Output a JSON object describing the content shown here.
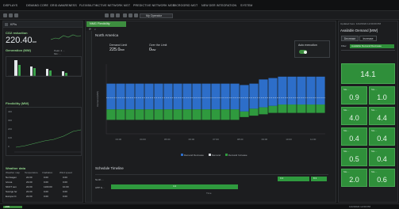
{
  "menu": {
    "items": [
      "DISPLAYS",
      "DEMAND CORE",
      "GRID AWARENESS",
      "FLEXIBILITY",
      "ACTIVE NETWORK MGT",
      "PREDICTIVE NETWORK MGT",
      "MICROGRID MGT",
      "NEW DER INTEGRATION",
      "SYSTEM"
    ]
  },
  "toolbar": {
    "operator_field": "My Operator"
  },
  "left_panel": {
    "header": "KPIs",
    "co2": {
      "title": "CO2 reduction",
      "value": "220.40",
      "unit": "ton"
    },
    "generation": {
      "title": "Generation (MW)",
      "legend": [
        "Peak: 4 ...",
        "Min: ..."
      ]
    },
    "flexibility": {
      "title": "Flexibility (MW)",
      "axis_ticks": [
        "400",
        "300",
        "200",
        "100",
        "0",
        "-100"
      ]
    },
    "weather": {
      "title": "Weather data",
      "columns": [
        "Weather map",
        "Temperature",
        "Irradiation",
        "Wind speed"
      ],
      "rows": [
        [
          "Norrsagen",
          "22.00",
          "0.00",
          "0.00"
        ],
        [
          "Ivrena",
          "23.00",
          "0.00",
          "0.00"
        ],
        [
          "SKOT sen",
          "22.00",
          "1100.00",
          "10.00"
        ],
        [
          "Sverige fer",
          "22.00",
          "0.00",
          "0.00"
        ],
        [
          "Europa Ct",
          "22.00",
          "0.00",
          "0.00"
        ]
      ]
    }
  },
  "main": {
    "tab": "NMG Flexibility",
    "region": "North America",
    "demand_limit_label": "Demand Limit",
    "demand_limit_value": "225.0",
    "demand_limit_unit": "MW",
    "over_limit_label": "Over the Limit",
    "over_limit_value": "0",
    "over_limit_unit": "MW",
    "auto_execution_label": "Auto execution",
    "schedule_title": "Schedule Timeline",
    "schedule_rows": [
      "North ...",
      "APP G..."
    ],
    "schedule_blocks": [
      "4.2",
      "3.4",
      "8.3"
    ],
    "legend": [
      "Demand Decrease",
      "Demand",
      "Demand Increase"
    ],
    "x_axis_label": "Time",
    "y_axis_label": "Demand (MW)"
  },
  "chart_data": {
    "type": "bar",
    "series": [
      {
        "name": "Demand Decrease",
        "color": "#2d6ec9",
        "top": [
          0.72,
          0.72,
          0.72,
          0.72,
          0.72,
          0.72,
          0.72,
          0.72,
          0.72,
          0.72,
          0.72,
          0.72,
          0.72,
          0.72,
          0.7,
          0.72,
          0.78,
          0.8,
          0.82,
          0.82,
          0.82,
          0.82,
          0.82
        ],
        "bottom": [
          0.35,
          0.35,
          0.35,
          0.35,
          0.35,
          0.35,
          0.35,
          0.35,
          0.35,
          0.35,
          0.35,
          0.35,
          0.35,
          0.35,
          0.32,
          0.36,
          0.38,
          0.4,
          0.42,
          0.42,
          0.42,
          0.42,
          0.42
        ]
      },
      {
        "name": "Demand Increase",
        "color": "#2f9a3e",
        "top": [
          0.35,
          0.35,
          0.35,
          0.35,
          0.35,
          0.35,
          0.35,
          0.35,
          0.35,
          0.35,
          0.35,
          0.35,
          0.35,
          0.35,
          0.32,
          0.36,
          0.38,
          0.4,
          0.42,
          0.42,
          0.42,
          0.42,
          0.42
        ],
        "bottom": [
          0.2,
          0.2,
          0.2,
          0.2,
          0.2,
          0.2,
          0.2,
          0.2,
          0.2,
          0.2,
          0.2,
          0.2,
          0.2,
          0.2,
          0.24,
          0.26,
          0.28,
          0.3,
          0.3,
          0.3,
          0.3,
          0.3,
          0.3
        ]
      }
    ],
    "limit_line": 0.52,
    "x_ticks": [
      "03:00",
      "04:00",
      "05:00",
      "06:00",
      "07:00",
      "08:00",
      "09:00",
      "10:00",
      "11:00"
    ]
  },
  "right_panel": {
    "updated": "Updated here: 12/2/2022 12:00:00 PM",
    "title": "Available Demand [MW]",
    "tabs": [
      "Decrease",
      "Increase"
    ],
    "filter_label": "Filter",
    "filter_value": "Available Demand Decrease",
    "total_value": "14.1",
    "tiles": [
      {
        "label": "Site ...",
        "value": "0.9"
      },
      {
        "label": "Site ...",
        "value": "1.0"
      },
      {
        "label": "Site ...",
        "value": "4.0"
      },
      {
        "label": "Site ...",
        "value": "4.4"
      },
      {
        "label": "Site ...",
        "value": "0.4"
      },
      {
        "label": "Site ...",
        "value": "0.4"
      },
      {
        "label": "Site ...",
        "value": "0.5"
      },
      {
        "label": "Site ...",
        "value": "0.4"
      },
      {
        "label": "Site ...",
        "value": "2.0"
      },
      {
        "label": "Site ...",
        "value": "0.6"
      }
    ]
  },
  "status": {
    "left": "ABB",
    "right": "12/2/2022  12:00 PM"
  },
  "colors": {
    "accent_green": "#3d8e3f",
    "blue": "#2d6ec9",
    "background": "#161718"
  }
}
